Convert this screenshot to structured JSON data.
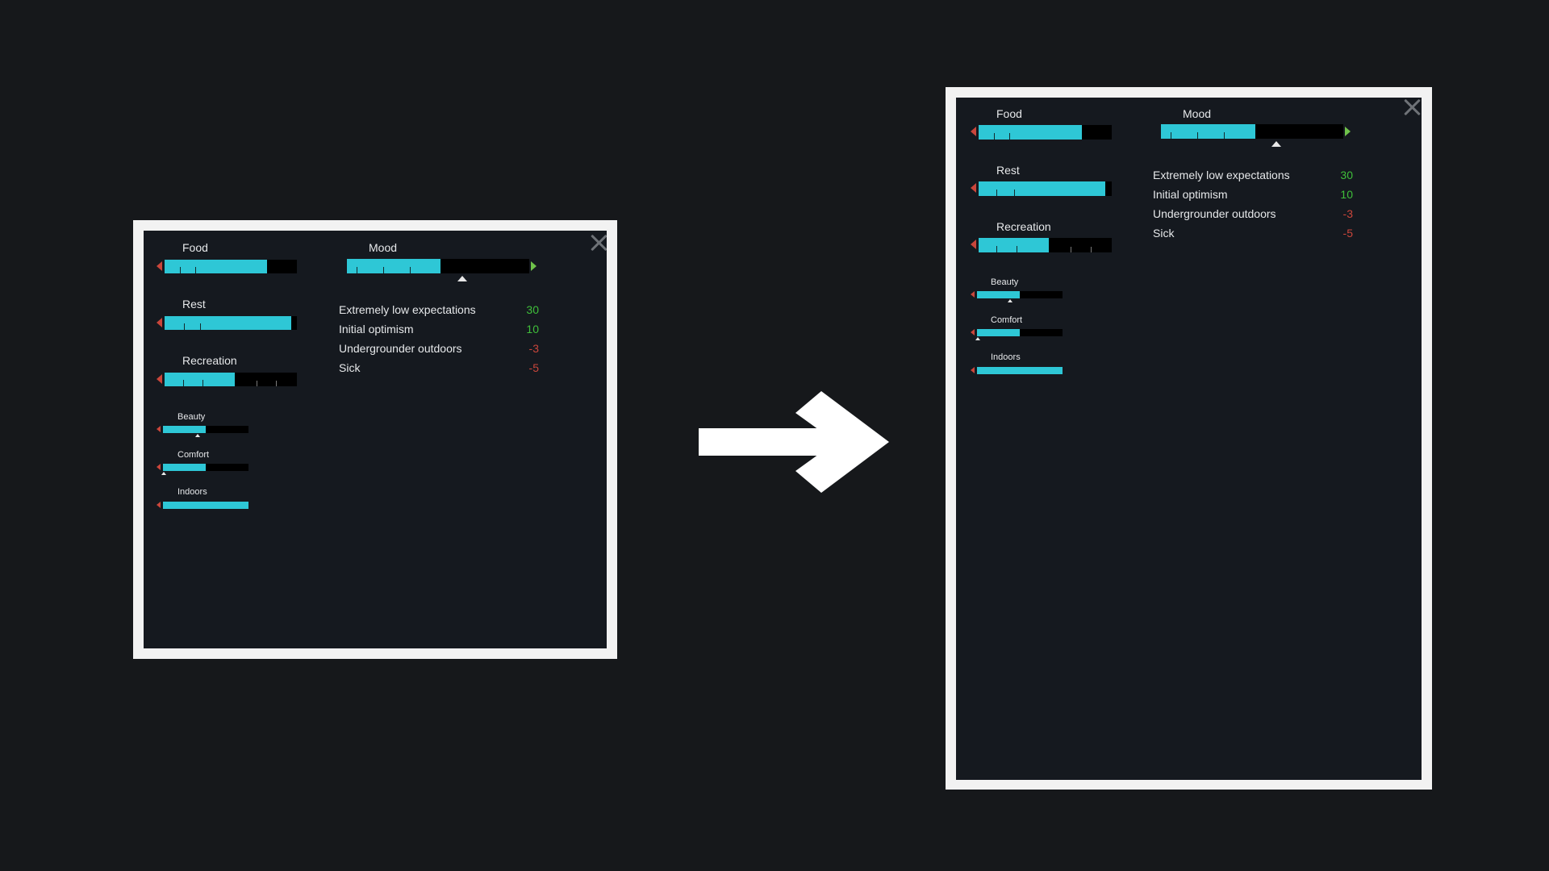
{
  "needs": {
    "food": {
      "label": "Food",
      "level": 0.78
    },
    "rest": {
      "label": "Rest",
      "level": 0.96
    },
    "recreation": {
      "label": "Recreation",
      "level": 0.53
    },
    "beauty": {
      "label": "Beauty",
      "level": 0.5
    },
    "comfort": {
      "label": "Comfort",
      "level": 0.5
    },
    "indoors": {
      "label": "Indoors",
      "level": 1.0
    }
  },
  "mood": {
    "label": "Mood",
    "level": 0.52
  },
  "thoughts": [
    {
      "label": "Extremely low expectations",
      "value": "30"
    },
    {
      "label": "Initial optimism",
      "value": "10"
    },
    {
      "label": "Undergrounder outdoors",
      "value": "-3"
    },
    {
      "label": "Sick",
      "value": "-5"
    }
  ],
  "colors": {
    "background": "#16181b",
    "panel": "#15191f",
    "bar_fill": "#2ec7d6",
    "positive": "#3fbf3a",
    "negative": "#c9463b"
  },
  "icons": {
    "close": "close-icon",
    "arrow": "right-arrow-icon"
  }
}
